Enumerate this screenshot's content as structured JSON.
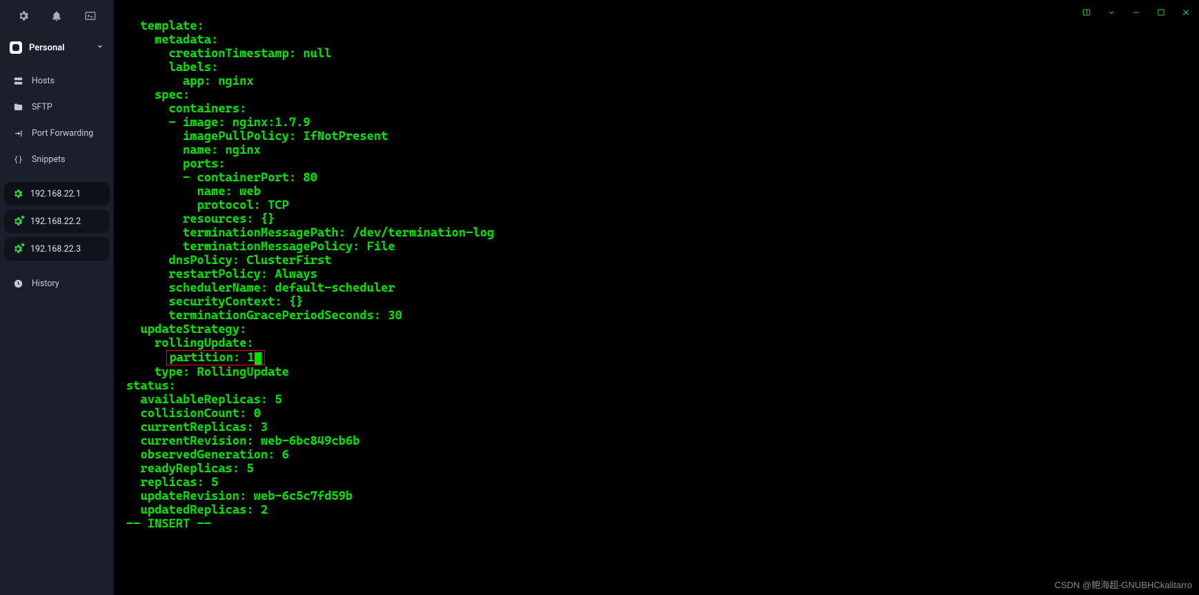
{
  "workspace": {
    "label": "Personal"
  },
  "nav": {
    "hosts": "Hosts",
    "sftp": "SFTP",
    "port_fwd": "Port Forwarding",
    "snippets": "Snippets",
    "history": "History"
  },
  "sessions": [
    {
      "ip": "192.168.22.1",
      "active": true,
      "connected": false
    },
    {
      "ip": "192.168.22.2",
      "active": false,
      "connected": true
    },
    {
      "ip": "192.168.22.3",
      "active": false,
      "connected": true
    }
  ],
  "terminal": {
    "lines": [
      "  template:",
      "    metadata:",
      "      creationTimestamp: null",
      "      labels:",
      "        app: nginx",
      "    spec:",
      "      containers:",
      "      - image: nginx:1.7.9",
      "        imagePullPolicy: IfNotPresent",
      "        name: nginx",
      "        ports:",
      "        - containerPort: 80",
      "          name: web",
      "          protocol: TCP",
      "        resources: {}",
      "        terminationMessagePath: /dev/termination-log",
      "        terminationMessagePolicy: File",
      "      dnsPolicy: ClusterFirst",
      "      restartPolicy: Always",
      "      schedulerName: default-scheduler",
      "      securityContext: {}",
      "      terminationGracePeriodSeconds: 30",
      "  updateStrategy:",
      "    rollingUpdate:"
    ],
    "highlight_prefix": "      ",
    "highlight_text": "partition: 1",
    "lines_after": [
      "    type: RollingUpdate",
      "status:",
      "  availableReplicas: 5",
      "  collisionCount: 0",
      "  currentReplicas: 3",
      "  currentRevision: web-6bc849cb6b",
      "  observedGeneration: 6",
      "  readyReplicas: 5",
      "  replicas: 5",
      "  updateRevision: web-6c5c7fd59b",
      "  updatedReplicas: 2",
      "-- INSERT --"
    ]
  },
  "watermark": "CSDN @鲍海超-GNUBHCkalitarro"
}
